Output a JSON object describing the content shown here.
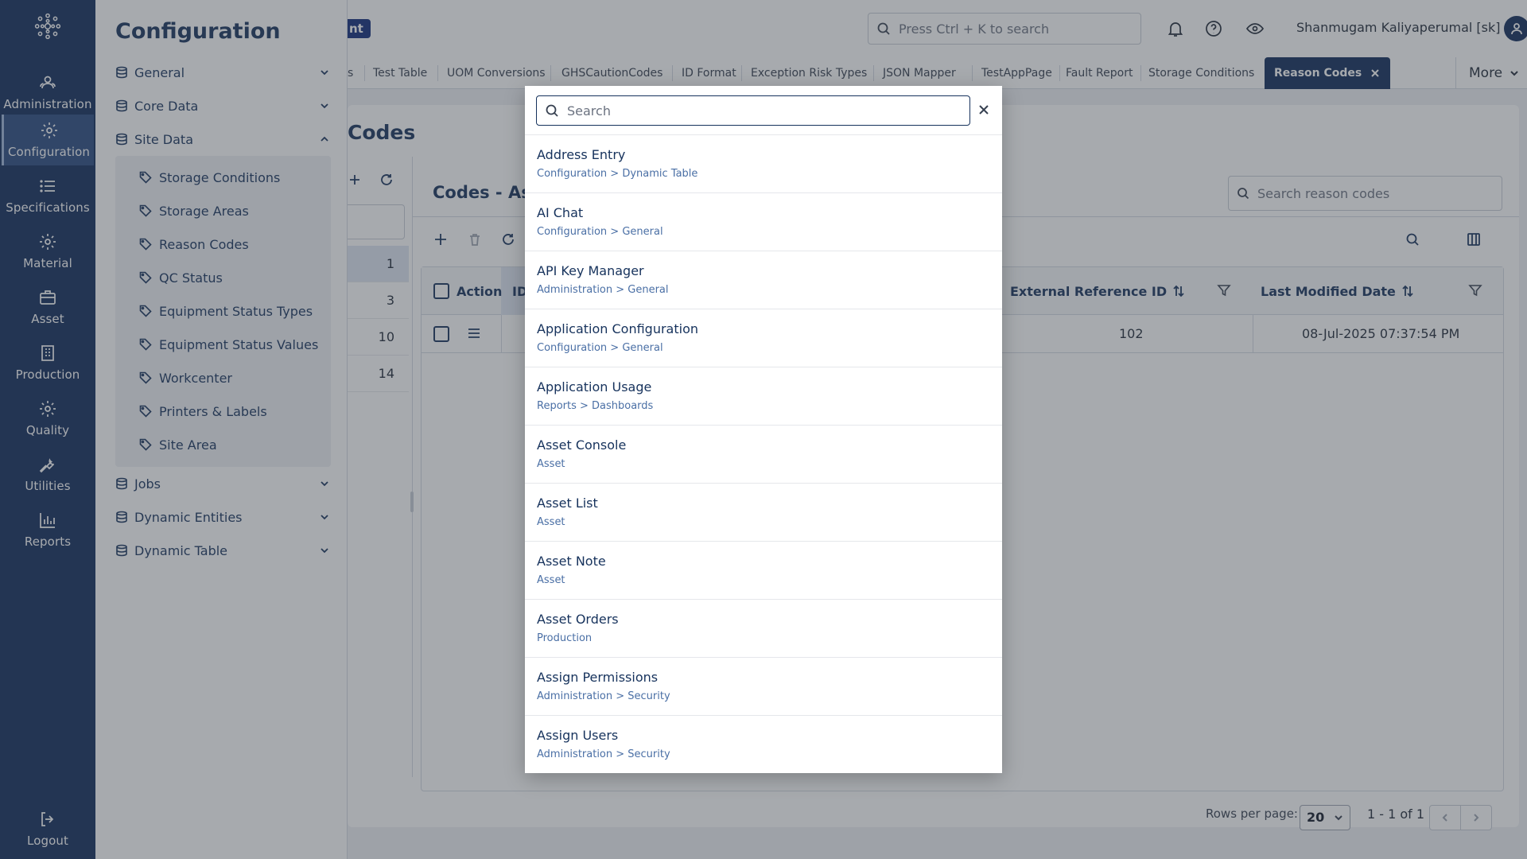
{
  "rail": {
    "items": [
      {
        "label": "Administration",
        "icon": "users-icon"
      },
      {
        "label": "Configuration",
        "icon": "gear-icon"
      },
      {
        "label": "Specifications",
        "icon": "list-icon"
      },
      {
        "label": "Material",
        "icon": "gear-icon"
      },
      {
        "label": "Asset",
        "icon": "briefcase-icon"
      },
      {
        "label": "Production",
        "icon": "building-icon"
      },
      {
        "label": "Quality",
        "icon": "gear-icon"
      },
      {
        "label": "Utilities",
        "icon": "wrench-icon"
      },
      {
        "label": "Reports",
        "icon": "bar-chart-icon"
      }
    ],
    "logout": "Logout",
    "active": "Configuration"
  },
  "config": {
    "title": "Configuration",
    "groups": [
      {
        "label": "General"
      },
      {
        "label": "Core Data"
      },
      {
        "label": "Site Data"
      },
      {
        "label": "Jobs"
      },
      {
        "label": "Dynamic Entities"
      },
      {
        "label": "Dynamic Table"
      }
    ],
    "site_data_items": [
      "Storage Conditions",
      "Storage Areas",
      "Reason Codes",
      "QC Status",
      "Equipment Status Types",
      "Equipment Status Values",
      "Workcenter",
      "Printers & Labels",
      "Site Area"
    ]
  },
  "header": {
    "badge": "nt",
    "search_placeholder": "Press Ctrl + K to search",
    "user_name": "Shanmugam Kaliyaperumal [sk]"
  },
  "tabs": {
    "items": [
      "s",
      "Test Table",
      "UOM Conversions",
      "GHSCautionCodes",
      "ID Format",
      "Exception Risk Types",
      "JSON Mapper",
      "TestAppPage",
      "Fault Report",
      "Storage Conditions"
    ],
    "active": "Reason Codes",
    "more": "More"
  },
  "page": {
    "title": "Codes",
    "list_rows": [
      "1",
      "3",
      "10",
      "14"
    ],
    "detail_title": "Codes - Ass",
    "detail_search_placeholder": "Search reason codes",
    "grid": {
      "headers": {
        "action": "Action",
        "id": "ID",
        "external_ref": "External Reference ID",
        "last_modified": "Last Modified Date"
      },
      "rows": [
        {
          "external_ref": "102",
          "last_modified": "08-Jul-2025 07:37:54 PM"
        }
      ]
    },
    "pager": {
      "rows_per_page_label": "Rows per page:",
      "rows_per_page": "20",
      "range": "1 - 1 of 1"
    }
  },
  "modal": {
    "search_placeholder": "Search",
    "results": [
      {
        "title": "Address Entry",
        "path": "Configuration > Dynamic Table"
      },
      {
        "title": "AI Chat",
        "path": "Configuration > General"
      },
      {
        "title": "API Key Manager",
        "path": "Administration > General"
      },
      {
        "title": "Application Configuration",
        "path": "Configuration > General"
      },
      {
        "title": "Application Usage",
        "path": "Reports > Dashboards"
      },
      {
        "title": "Asset Console",
        "path": "Asset"
      },
      {
        "title": "Asset List",
        "path": "Asset"
      },
      {
        "title": "Asset Note",
        "path": "Asset"
      },
      {
        "title": "Asset Orders",
        "path": "Production"
      },
      {
        "title": "Assign Permissions",
        "path": "Administration > Security"
      },
      {
        "title": "Assign Users",
        "path": "Administration > Security"
      }
    ]
  },
  "colors": {
    "navy": "#0f2a5a",
    "accent_text": "#16325c",
    "overlay": "rgba(60,66,76,0.45)"
  }
}
